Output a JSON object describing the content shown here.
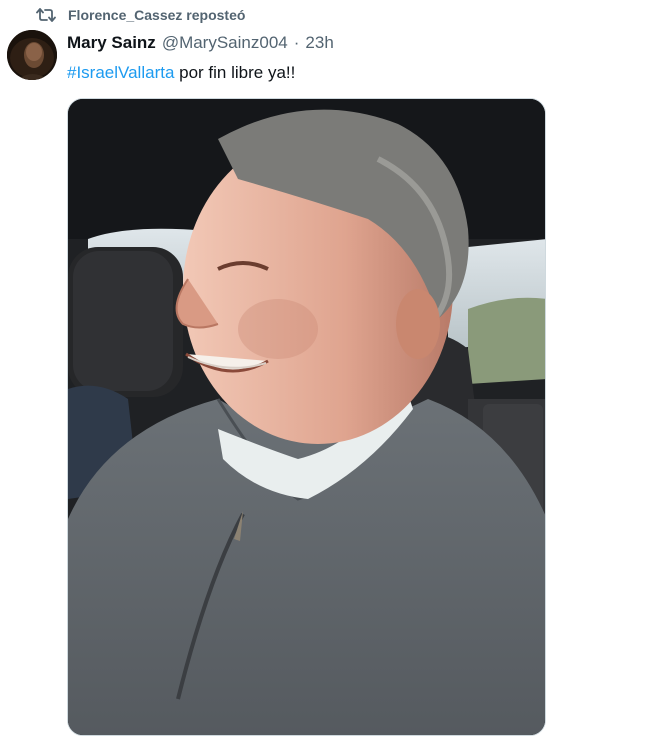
{
  "repost": {
    "icon": "repost-icon",
    "text": "Florence_Cassez reposteó"
  },
  "tweet": {
    "author_name": "Mary Sainz",
    "author_handle": "@MarySainz004",
    "separator": "·",
    "timestamp": "23h",
    "hashtag": "#IsraelVallarta",
    "body": " por fin libre ya!!",
    "avatar_icon": "avatar",
    "media_icon": "photo-man-smiling-in-car"
  },
  "colors": {
    "accent": "#1d9bf0",
    "secondary_text": "#536471",
    "primary_text": "#0f1419"
  }
}
